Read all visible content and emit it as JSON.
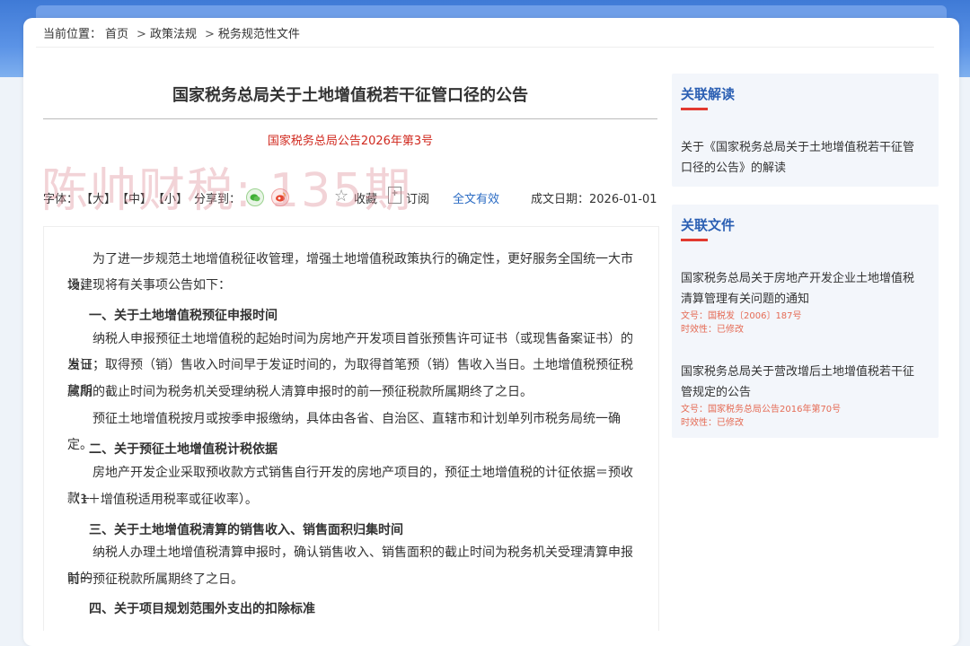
{
  "breadcrumb": {
    "prefix": "当前位置：",
    "items": [
      "首页",
      "政策法规",
      "税务规范性文件"
    ],
    "sep": ">"
  },
  "article": {
    "title": "国家税务总局关于土地增值税若干征管口径的公告",
    "doc_no": "国家税务总局公告2026年第3号",
    "watermark": "陈帅财税: 135期",
    "toolbar": {
      "font_label": "字体：",
      "size_big": "【大】",
      "size_mid": "【中】",
      "size_small": "【小】",
      "share_label": "分享到：",
      "wechat_icon": "wechat-icon",
      "weibo_icon": "weibo-icon",
      "favorite": "收藏",
      "subscribe": "订阅",
      "validity": "全文有效",
      "date_label": "成文日期：2026-01-01"
    },
    "body": {
      "intro_1": "为了进一步规范土地增值税征收管理，增强土地增值税政策执行的确定性，更好服务全国统一大市场建",
      "intro_2": "设，现将有关事项公告如下：",
      "h1": "一、关于土地增值税预征申报时间",
      "p1_1": "纳税人申报预征土地增值税的起始时间为房地产开发项目首张预售许可证书（或现售备案证书）的发证",
      "p1_2": "当日；取得预（销）售收入时间早于发证时间的，为取得首笔预（销）售收入当日。土地增值税预征税款所",
      "p1_3": "属期的截止时间为税务机关受理纳税人清算申报时的前一预征税款所属期终了之日。",
      "p2_1": "预征土地增值税按月或按季申报缴纳，具体由各省、自治区、直辖市和计划单列市税务局统一确定。",
      "h2": "二、关于预征土地增值税计税依据",
      "p3_1": "房地产开发企业采取预收款方式销售自行开发的房地产项目的，预征土地增值税的计征依据＝预收款÷",
      "p3_2": "（1＋增值税适用税率或征收率）。",
      "h3": "三、关于土地增值税清算的销售收入、销售面积归集时间",
      "p4_1": "纳税人办理土地增值税清算申报时，确认销售收入、销售面积的截止时间为税务机关受理清算申报时的",
      "p4_2": "前一预征税款所属期终了之日。",
      "h4": "四、关于项目规划范围外支出的扣除标准"
    }
  },
  "sidebar": {
    "related_reading": {
      "heading": "关联解读",
      "link_1": "关于《国家税务总局关于土地增值税若干征管",
      "link_2": "口径的公告》的解读"
    },
    "related_files": {
      "heading": "关联文件",
      "items": [
        {
          "title_1": "国家税务总局关于房地产开发企业土地增值税",
          "title_2": "清算管理有关问题的通知",
          "doc_no": "文号：国税发〔2006〕187号",
          "status": "时效性：已修改"
        },
        {
          "title_1": "国家税务总局关于营改增后土地增值税若干征",
          "title_2": "管规定的公告",
          "doc_no": "文号：国家税务总局公告2016年第70号",
          "status": "时效性：已修改"
        }
      ]
    }
  },
  "colors": {
    "accent_blue": "#2b5fb3",
    "doc_red": "#d0281e",
    "header_blue": "#3f7ad6"
  }
}
